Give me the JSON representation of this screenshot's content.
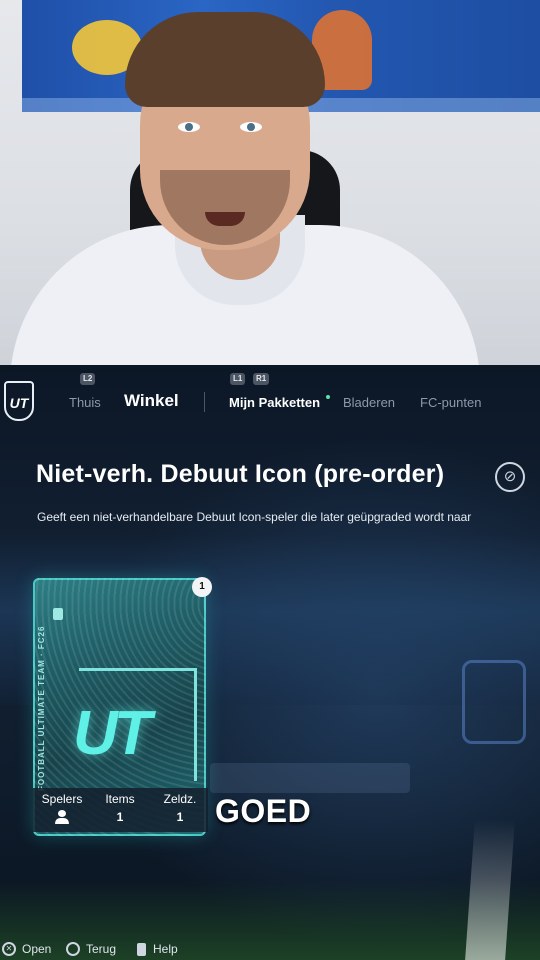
{
  "nav": {
    "shoulder_left": "L2",
    "shoulder_center_left": "L1",
    "shoulder_center_right": "R1",
    "logo_text": "UT",
    "tabs": [
      "Thuis",
      "Winkel"
    ],
    "subtabs": [
      "Mijn Pakketten",
      "Bladeren",
      "FC-punten"
    ]
  },
  "pack": {
    "title": "Niet-verh. Debuut Icon (pre-order)",
    "description": "Geeft een niet-verhandelbare Debuut Icon-speler die later geüpgraded wordt naar",
    "count": "1",
    "side_text": "FOOTBALL ULTIMATE TEAM · FC26",
    "art_text": "UT",
    "stats": [
      {
        "label": "Spelers",
        "value": ""
      },
      {
        "label": "Items",
        "value": "1"
      },
      {
        "label": "Zeldz.",
        "value": "1"
      }
    ]
  },
  "caption": "GOED",
  "footer": {
    "open": "Open",
    "back": "Terug",
    "help": "Help"
  },
  "colors": {
    "accent": "#5ff0e6",
    "nav_active": "#ffffff",
    "nav_inactive": "#8d99ab",
    "new_dot": "#5ee1a8"
  },
  "icons": [
    "no-trade-icon",
    "person-icon",
    "cross-button-icon",
    "circle-button-icon",
    "touchpad-icon"
  ]
}
